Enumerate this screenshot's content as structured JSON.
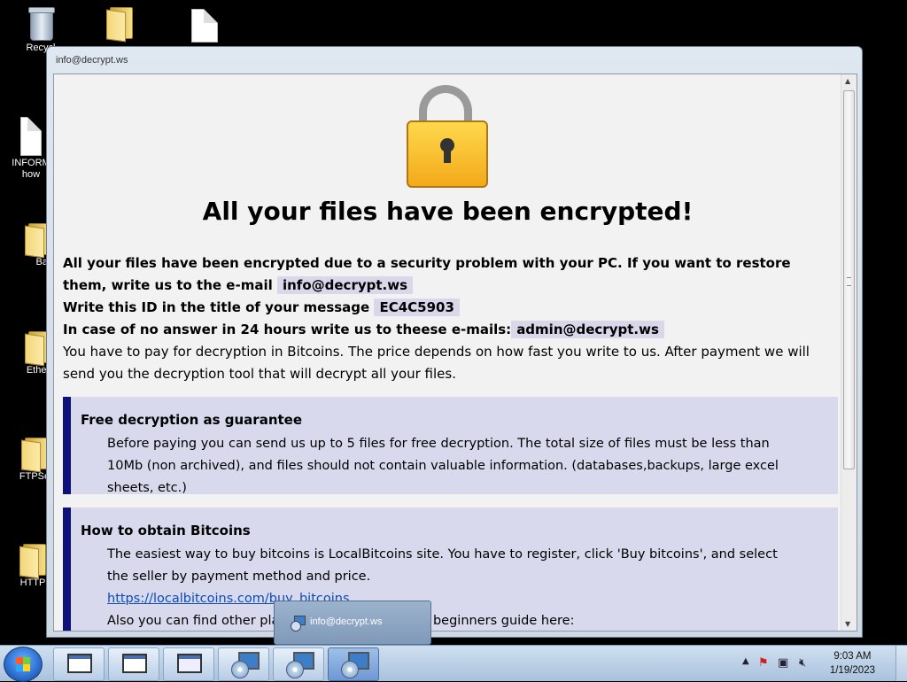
{
  "desktop": {
    "icons": [
      {
        "label": "Recycl"
      },
      {
        "label": ""
      },
      {
        "label": ""
      },
      {
        "label": "INFORM",
        "label2": "how"
      },
      {
        "label": "Bas"
      },
      {
        "label": "Ether"
      },
      {
        "label": "FTPSe"
      },
      {
        "label": "HTTP"
      }
    ]
  },
  "window": {
    "title": "info@decrypt.ws",
    "headline": "All your files have been encrypted!",
    "intro_bold": "All your files have been encrypted due to a security problem with your PC. If you want to restore them, write us to the e-mail",
    "email": "info@decrypt.ws",
    "id_label": "Write this ID in the title of your message",
    "id_value": "EC4C5903",
    "alt_label": "In case of no answer in 24 hours write us to theese e-mails:",
    "alt_email": "admin@decrypt.ws",
    "pay_text": "You have to pay for decryption in Bitcoins. The price depends on how fast you write to us. After payment we will send you the decryption tool that will decrypt all your files.",
    "box1": {
      "title": "Free decryption as guarantee",
      "text": "Before paying you can send us up to 5 files for free decryption. The total size of files must be less than 10Mb (non archived), and files should not contain valuable information. (databases,backups, large excel sheets, etc.)"
    },
    "box2": {
      "title": "How to obtain Bitcoins",
      "text": "The easiest way to buy bitcoins is LocalBitcoins site. You have to register, click 'Buy bitcoins', and select the seller by payment method and price.",
      "link": "https://localbitcoins.com/buy_bitcoins",
      "more": "Also you can find other places to buy Bitcoins and beginners guide here:"
    }
  },
  "popup": {
    "label": "info@decrypt.ws"
  },
  "taskbar": {
    "time": "9:03 AM",
    "date": "1/19/2023"
  }
}
